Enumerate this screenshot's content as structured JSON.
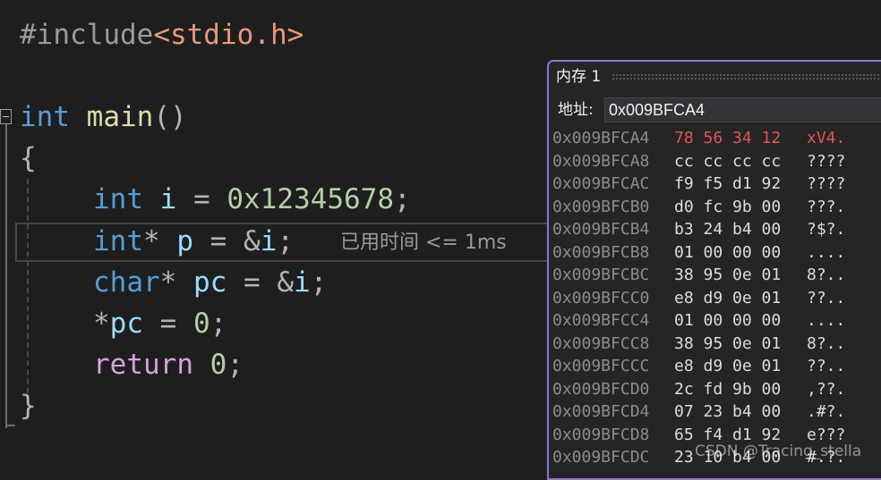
{
  "editor": {
    "lines": {
      "include": {
        "directive": "#include",
        "header": "<stdio.h>"
      },
      "main_decl": {
        "type": "int",
        "name": "main",
        "parens": "()"
      },
      "open_brace": "{",
      "decl_i": {
        "type": "int",
        "var": "i",
        "eq": " = ",
        "value": "0x12345678",
        "semi": ";"
      },
      "decl_p": {
        "type": "int",
        "star": "*",
        "var": "p",
        "eq": " = ",
        "amp": "&",
        "target": "i",
        "semi": ";"
      },
      "decl_pc": {
        "type": "char",
        "star": "*",
        "var": "pc",
        "eq": " = ",
        "amp": "&",
        "target": "i",
        "semi": ";"
      },
      "assign": {
        "star": "*",
        "var": "pc",
        "eq": " = ",
        "value": "0",
        "semi": ";"
      },
      "ret": {
        "keyword": "return",
        "value": "0",
        "semi": ";"
      },
      "close_brace": "}"
    },
    "perf_tip": "已用时间 <= 1ms"
  },
  "memory_window": {
    "title": "内存 1",
    "address_label": "地址:",
    "address_value": "0x009BFCA4",
    "rows": [
      {
        "addr": "0x009BFCA4",
        "bytes": "78 56 34 12",
        "ascii": "xV4.",
        "changed": true
      },
      {
        "addr": "0x009BFCA8",
        "bytes": "cc cc cc cc",
        "ascii": "????"
      },
      {
        "addr": "0x009BFCAC",
        "bytes": "f9 f5 d1 92",
        "ascii": "????"
      },
      {
        "addr": "0x009BFCB0",
        "bytes": "d0 fc 9b 00",
        "ascii": "???."
      },
      {
        "addr": "0x009BFCB4",
        "bytes": "b3 24 b4 00",
        "ascii": "?$?."
      },
      {
        "addr": "0x009BFCB8",
        "bytes": "01 00 00 00",
        "ascii": "...."
      },
      {
        "addr": "0x009BFCBC",
        "bytes": "38 95 0e 01",
        "ascii": "8?.."
      },
      {
        "addr": "0x009BFCC0",
        "bytes": "e8 d9 0e 01",
        "ascii": "??.."
      },
      {
        "addr": "0x009BFCC4",
        "bytes": "01 00 00 00",
        "ascii": "...."
      },
      {
        "addr": "0x009BFCC8",
        "bytes": "38 95 0e 01",
        "ascii": "8?.."
      },
      {
        "addr": "0x009BFCCC",
        "bytes": "e8 d9 0e 01",
        "ascii": "??.."
      },
      {
        "addr": "0x009BFCD0",
        "bytes": "2c fd 9b 00",
        "ascii": ",??."
      },
      {
        "addr": "0x009BFCD4",
        "bytes": "07 23 b4 00",
        "ascii": ".#?."
      },
      {
        "addr": "0x009BFCD8",
        "bytes": "65 f4 d1 92",
        "ascii": "e???"
      },
      {
        "addr": "0x009BFCDC",
        "bytes": "23 10 b4 00",
        "ascii": "#.?."
      }
    ]
  },
  "watermark": "CSDN @Tracing_stella",
  "colors": {
    "editor_bg": "#1e1e1e",
    "keyword": "#569cd6",
    "control_keyword": "#d8a0df",
    "function": "#dcdcaa",
    "variable": "#9cdcfe",
    "number": "#b5cea8",
    "string": "#e7987c",
    "changed_memory": "#e05454",
    "window_border": "#8f75c7"
  }
}
